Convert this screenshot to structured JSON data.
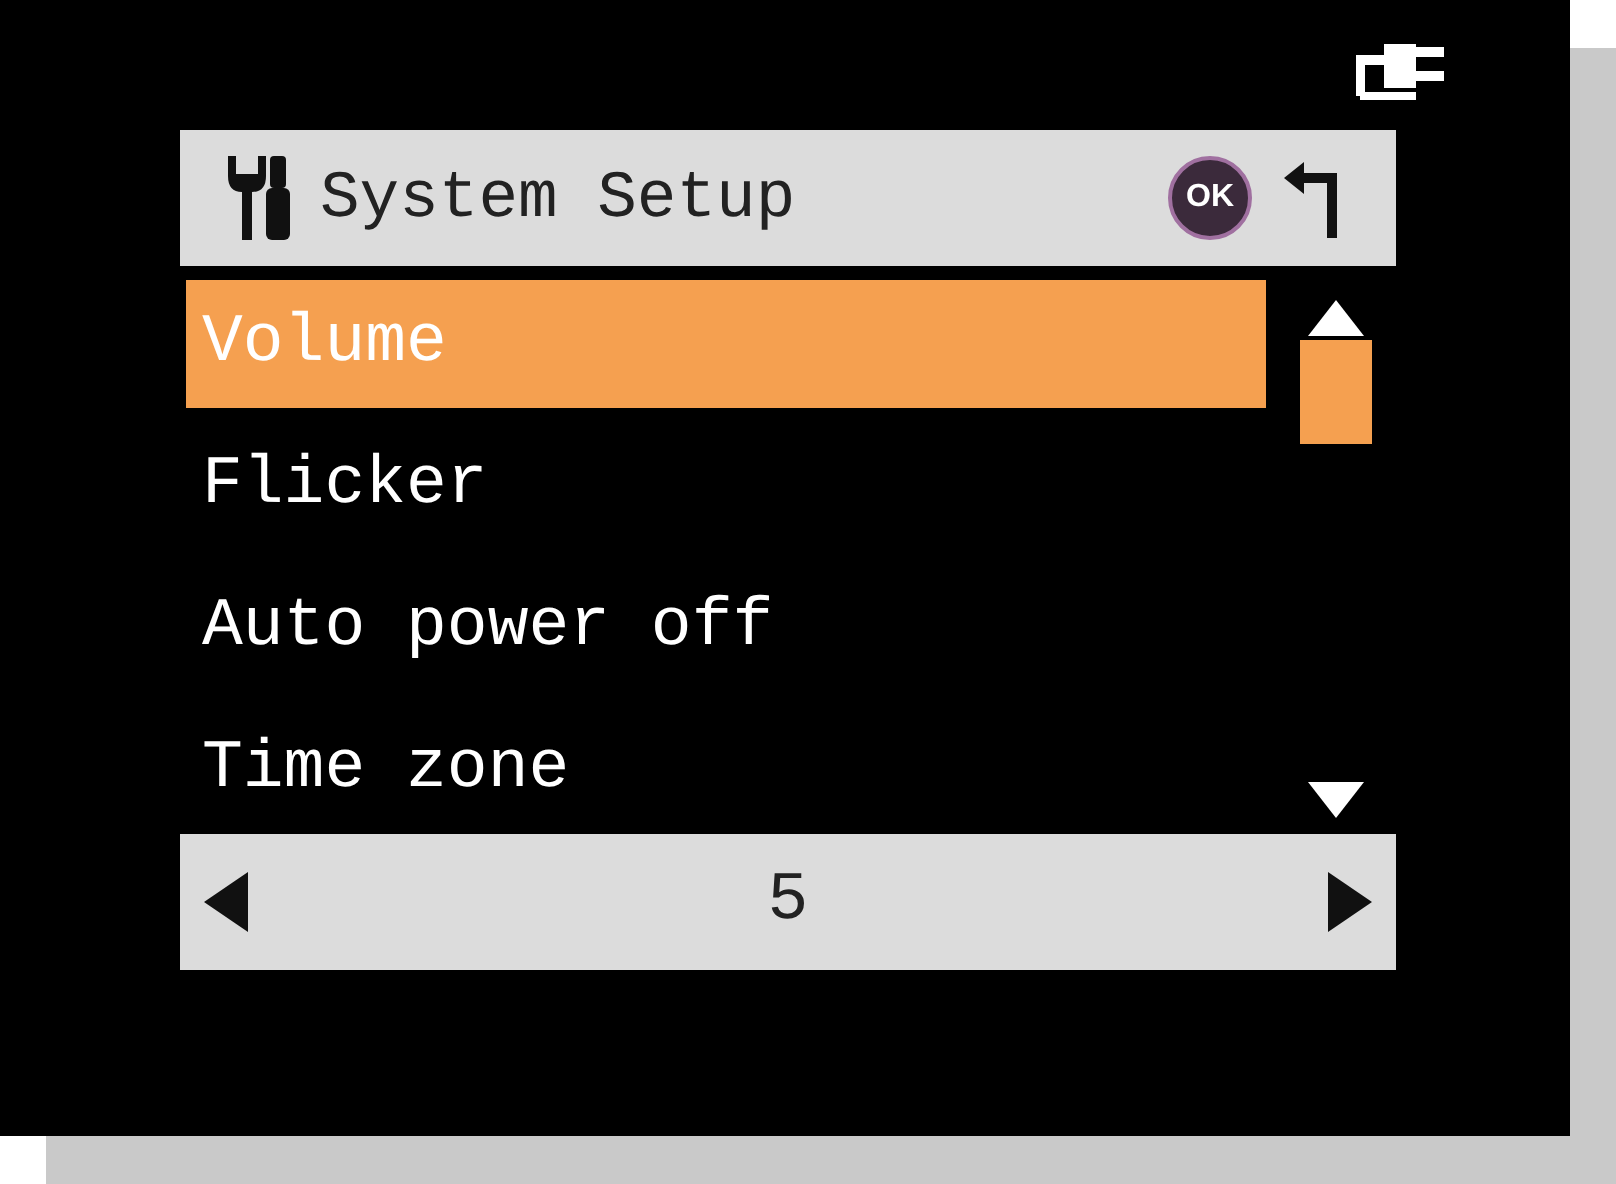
{
  "header": {
    "title": "System Setup",
    "ok_label": "OK"
  },
  "menu": [
    {
      "label": "Volume",
      "selected": true
    },
    {
      "label": "Flicker",
      "selected": false
    },
    {
      "label": "Auto power off",
      "selected": false
    },
    {
      "label": "Time zone",
      "selected": false
    }
  ],
  "value_bar": {
    "value": "5"
  }
}
